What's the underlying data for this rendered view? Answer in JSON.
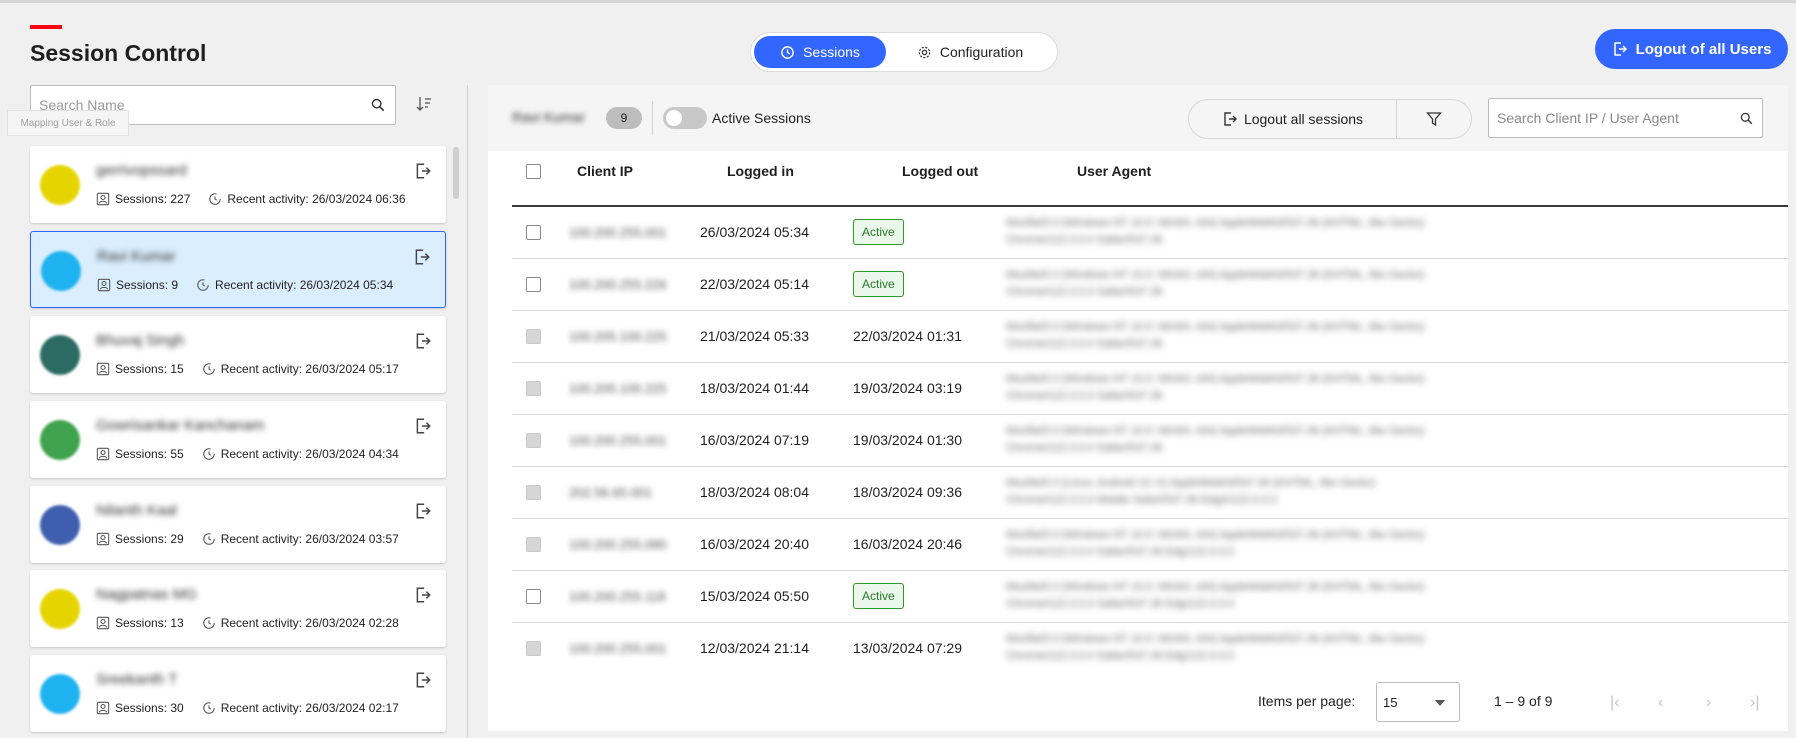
{
  "page": {
    "title": "Session Control"
  },
  "nav": {
    "tabs": [
      {
        "label": "Sessions",
        "icon": "sessions-icon",
        "active": true
      },
      {
        "label": "Configuration",
        "icon": "gear-icon",
        "active": false
      }
    ],
    "logout_all_users": "Logout of all Users"
  },
  "sidebar": {
    "search_placeholder": "Search Name",
    "tooltip": "Mapping User & Role",
    "users": [
      {
        "name": "gerrivopssard",
        "sessions": "Sessions: 227",
        "activity": "Recent activity: 26/03/2024 06:36",
        "avatar_color": "#e5d400",
        "selected": false
      },
      {
        "name": "Ravi Kumar",
        "sessions": "Sessions: 9",
        "activity": "Recent activity: 26/03/2024 05:34",
        "avatar_color": "#1fb2f0",
        "selected": true
      },
      {
        "name": "Bhuvaj Singh",
        "sessions": "Sessions: 15",
        "activity": "Recent activity: 26/03/2024 05:17",
        "avatar_color": "#2b6b63",
        "selected": false
      },
      {
        "name": "Gowrisankar Kanchanam",
        "sessions": "Sessions: 55",
        "activity": "Recent activity: 26/03/2024 04:34",
        "avatar_color": "#3fa34d",
        "selected": false
      },
      {
        "name": "Nilanth Kaal",
        "sessions": "Sessions: 29",
        "activity": "Recent activity: 26/03/2024 03:57",
        "avatar_color": "#3f5fae",
        "selected": false
      },
      {
        "name": "Nagpatnas MG",
        "sessions": "Sessions: 13",
        "activity": "Recent activity: 26/03/2024 02:28",
        "avatar_color": "#e5d400",
        "selected": false
      },
      {
        "name": "Sreekanth T",
        "sessions": "Sessions: 30",
        "activity": "Recent activity: 26/03/2024 02:17",
        "avatar_color": "#1fb2f0",
        "selected": false
      }
    ]
  },
  "main": {
    "selected_user": "Ravi Kumar",
    "session_count": "9",
    "toggle_label": "Active Sessions",
    "logout_all_sessions": "Logout all sessions",
    "search_placeholder": "Search Client IP / User Agent",
    "columns": [
      "Client IP",
      "Logged in",
      "Logged out",
      "User Agent"
    ],
    "rows": [
      {
        "ip": "100.200.255.001",
        "login": "26/03/2024 05:34",
        "logout": "",
        "active": true,
        "enabled": true,
        "agent1": "Mozilla/5.0 (Windows NT 10.0; Win64; x64) AppleWebKit/537.36 (KHTML, like Gecko)",
        "agent2": "Chrome/122.0.0.0 Safari/537.36"
      },
      {
        "ip": "100.200.255.226",
        "login": "22/03/2024 05:14",
        "logout": "",
        "active": true,
        "enabled": true,
        "agent1": "Mozilla/5.0 (Windows NT 10.0; Win64; x64) AppleWebKit/537.36 (KHTML, like Gecko)",
        "agent2": "Chrome/122.0.0.0 Safari/537.36"
      },
      {
        "ip": "100.205.100.225",
        "login": "21/03/2024 05:33",
        "logout": "22/03/2024 01:31",
        "active": false,
        "enabled": false,
        "agent1": "Mozilla/5.0 (Windows NT 10.0; Win64; x64) AppleWebKit/537.36 (KHTML, like Gecko)",
        "agent2": "Chrome/122.0.0.0 Safari/537.36"
      },
      {
        "ip": "100.205.100.225",
        "login": "18/03/2024 01:44",
        "logout": "19/03/2024 03:19",
        "active": false,
        "enabled": false,
        "agent1": "Mozilla/5.0 (Windows NT 10.0; Win64; x64) AppleWebKit/537.36 (KHTML, like Gecko)",
        "agent2": "Chrome/122.0.0.0 Safari/537.36"
      },
      {
        "ip": "100.200.255.001",
        "login": "16/03/2024 07:19",
        "logout": "19/03/2024 01:30",
        "active": false,
        "enabled": false,
        "agent1": "Mozilla/5.0 (Windows NT 10.0; Win64; x64) AppleWebKit/537.36 (KHTML, like Gecko)",
        "agent2": "Chrome/122.0.0.0 Safari/537.36"
      },
      {
        "ip": "202.56.65.001",
        "login": "18/03/2024 08:04",
        "logout": "18/03/2024 09:36",
        "active": false,
        "enabled": false,
        "agent1": "Mozilla/5.0 (Linux; Android 10; K) AppleWebKit/537.36 (KHTML, like Gecko)",
        "agent2": "Chrome/122.0.0.0 Mobile Safari/537.36 EdgA/122.0.0.0"
      },
      {
        "ip": "100.200.255.080",
        "login": "16/03/2024 20:40",
        "logout": "16/03/2024 20:46",
        "active": false,
        "enabled": false,
        "agent1": "Mozilla/5.0 (Windows NT 10.0; Win64; x64) AppleWebKit/537.36 (KHTML, like Gecko)",
        "agent2": "Chrome/122.0.0.0 Safari/537.36 Edg/122.0.0.0"
      },
      {
        "ip": "100.200.255.118",
        "login": "15/03/2024 05:50",
        "logout": "",
        "active": true,
        "enabled": true,
        "agent1": "Mozilla/5.0 (Windows NT 10.0; Win64; x64) AppleWebKit/537.36 (KHTML, like Gecko)",
        "agent2": "Chrome/122.0.0.0 Safari/537.36 Edg/122.0.0.0"
      },
      {
        "ip": "100.200.255.001",
        "login": "12/03/2024 21:14",
        "logout": "13/03/2024 07:29",
        "active": false,
        "enabled": false,
        "agent1": "Mozilla/5.0 (Windows NT 10.0; Win64; x64) AppleWebKit/537.36 (KHTML, like Gecko)",
        "agent2": "Chrome/122.0.0.0 Safari/537.36 Edg/122.0.0.0"
      }
    ],
    "active_label": "Active",
    "pagination": {
      "items_per_page_label": "Items per page:",
      "items_per_page": "15",
      "range": "1 – 9 of 9"
    }
  },
  "colors": {
    "accent": "#3366ff",
    "brand": "#ff000f",
    "active_green": "#2a9d2a",
    "selected_bg": "#dbeefd"
  }
}
